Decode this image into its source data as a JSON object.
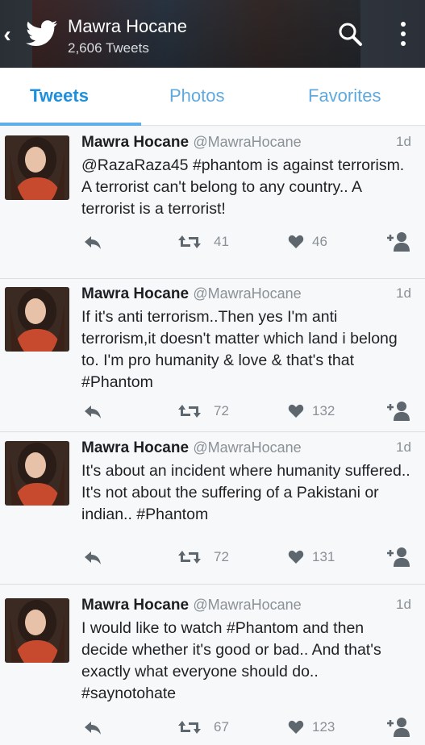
{
  "header": {
    "title": "Mawra Hocane",
    "subtitle": "2,606 Tweets"
  },
  "tabs": [
    {
      "label": "Tweets",
      "active": true
    },
    {
      "label": "Photos",
      "active": false
    },
    {
      "label": "Favorites",
      "active": false
    }
  ],
  "tweets": [
    {
      "name": "Mawra Hocane",
      "handle": "@MawraHocane",
      "time": "1d",
      "text": "@RazaRaza45 #phantom is against terrorism. A terrorist can't belong to any country.. A terrorist is a terrorist!",
      "retweets": "41",
      "likes": "46"
    },
    {
      "name": "Mawra Hocane",
      "handle": "@MawraHocane",
      "time": "1d",
      "text": "If it's anti terrorism..Then yes I'm anti terrorism,it doesn't matter which land i belong to. I'm pro humanity & love & that's that #Phantom",
      "retweets": "72",
      "likes": "132"
    },
    {
      "name": "Mawra Hocane",
      "handle": "@MawraHocane",
      "time": "1d",
      "text": "It's about an incident where humanity suffered.. It's not about the suffering of a Pakistani or indian.. #Phantom",
      "retweets": "72",
      "likes": "131"
    },
    {
      "name": "Mawra Hocane",
      "handle": "@MawraHocane",
      "time": "1d",
      "text": "I would like to watch #Phantom and then decide whether it's good or bad.. And that's exactly what everyone should do.. #saynotohate",
      "retweets": "67",
      "likes": "123"
    }
  ],
  "colors": {
    "accent": "#1d8fdc",
    "tab_inactive": "#5fa9dd",
    "icon_gray": "#6d747b",
    "background": "#f7f8f9"
  },
  "icons": {
    "back": "chevron-left-icon",
    "logo": "twitter-bird-icon",
    "search": "search-icon",
    "more": "more-vertical-icon",
    "reply": "reply-icon",
    "retweet": "retweet-icon",
    "like": "heart-icon",
    "follow": "add-user-icon"
  }
}
